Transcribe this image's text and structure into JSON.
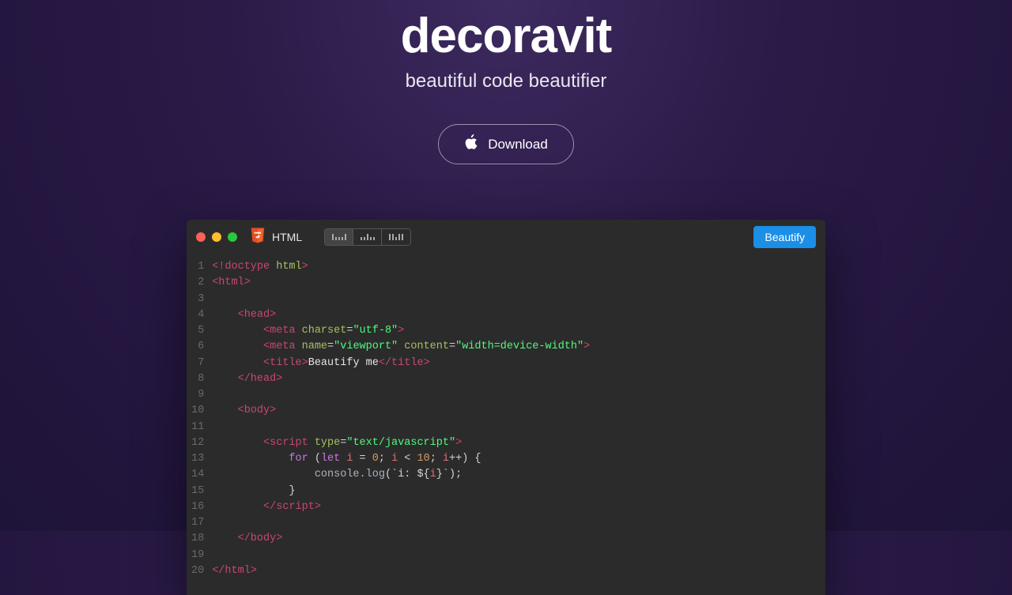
{
  "hero": {
    "title": "decoravit",
    "subtitle": "beautiful code beautifier",
    "download_label": "Download"
  },
  "editor": {
    "language_label": "HTML",
    "beautify_label": "Beautify",
    "line_count": 20,
    "code_lines": [
      {
        "indent": 0,
        "tokens": [
          {
            "c": "t-tag",
            "t": "<!doctype "
          },
          {
            "c": "t-attr",
            "t": "html"
          },
          {
            "c": "t-tag",
            "t": ">"
          }
        ]
      },
      {
        "indent": 0,
        "tokens": [
          {
            "c": "t-tag",
            "t": "<html>"
          }
        ]
      },
      {
        "indent": 0,
        "tokens": []
      },
      {
        "indent": 1,
        "tokens": [
          {
            "c": "t-tag",
            "t": "<head>"
          }
        ]
      },
      {
        "indent": 2,
        "tokens": [
          {
            "c": "t-tag",
            "t": "<meta "
          },
          {
            "c": "t-attr",
            "t": "charset"
          },
          {
            "c": "t-punc",
            "t": "="
          },
          {
            "c": "t-str",
            "t": "\"utf-8\""
          },
          {
            "c": "t-tag",
            "t": ">"
          }
        ]
      },
      {
        "indent": 2,
        "tokens": [
          {
            "c": "t-tag",
            "t": "<meta "
          },
          {
            "c": "t-attr",
            "t": "name"
          },
          {
            "c": "t-punc",
            "t": "="
          },
          {
            "c": "t-str",
            "t": "\"viewport\""
          },
          {
            "c": "t-tag",
            "t": " "
          },
          {
            "c": "t-attr",
            "t": "content"
          },
          {
            "c": "t-punc",
            "t": "="
          },
          {
            "c": "t-str",
            "t": "\"width=device-width\""
          },
          {
            "c": "t-tag",
            "t": ">"
          }
        ]
      },
      {
        "indent": 2,
        "tokens": [
          {
            "c": "t-tag",
            "t": "<title>"
          },
          {
            "c": "t-plain",
            "t": "Beautify me"
          },
          {
            "c": "t-tag",
            "t": "</title>"
          }
        ]
      },
      {
        "indent": 1,
        "tokens": [
          {
            "c": "t-tag",
            "t": "</head>"
          }
        ]
      },
      {
        "indent": 0,
        "tokens": []
      },
      {
        "indent": 1,
        "tokens": [
          {
            "c": "t-tag",
            "t": "<body>"
          }
        ]
      },
      {
        "indent": 0,
        "tokens": []
      },
      {
        "indent": 2,
        "tokens": [
          {
            "c": "t-tag",
            "t": "<script "
          },
          {
            "c": "t-attr",
            "t": "type"
          },
          {
            "c": "t-punc",
            "t": "="
          },
          {
            "c": "t-str",
            "t": "\"text/javascript\""
          },
          {
            "c": "t-tag",
            "t": ">"
          }
        ]
      },
      {
        "indent": 3,
        "tokens": [
          {
            "c": "t-key",
            "t": "for "
          },
          {
            "c": "t-punc",
            "t": "("
          },
          {
            "c": "t-key",
            "t": "let "
          },
          {
            "c": "t-id",
            "t": "i"
          },
          {
            "c": "t-punc",
            "t": " = "
          },
          {
            "c": "t-num",
            "t": "0"
          },
          {
            "c": "t-punc",
            "t": "; "
          },
          {
            "c": "t-id",
            "t": "i"
          },
          {
            "c": "t-punc",
            "t": " < "
          },
          {
            "c": "t-num",
            "t": "10"
          },
          {
            "c": "t-punc",
            "t": "; "
          },
          {
            "c": "t-id",
            "t": "i"
          },
          {
            "c": "t-punc",
            "t": "++) {"
          }
        ]
      },
      {
        "indent": 4,
        "tokens": [
          {
            "c": "t-fn",
            "t": "console.log"
          },
          {
            "c": "t-punc",
            "t": "(`i: ${"
          },
          {
            "c": "t-id",
            "t": "i"
          },
          {
            "c": "t-punc",
            "t": "}`);"
          }
        ]
      },
      {
        "indent": 3,
        "tokens": [
          {
            "c": "t-punc",
            "t": "}"
          }
        ]
      },
      {
        "indent": 2,
        "tokens": [
          {
            "c": "t-tag",
            "t": "</script​>"
          }
        ]
      },
      {
        "indent": 0,
        "tokens": []
      },
      {
        "indent": 1,
        "tokens": [
          {
            "c": "t-tag",
            "t": "</body>"
          }
        ]
      },
      {
        "indent": 0,
        "tokens": []
      },
      {
        "indent": 0,
        "tokens": [
          {
            "c": "t-tag",
            "t": "</html>"
          }
        ]
      }
    ]
  }
}
